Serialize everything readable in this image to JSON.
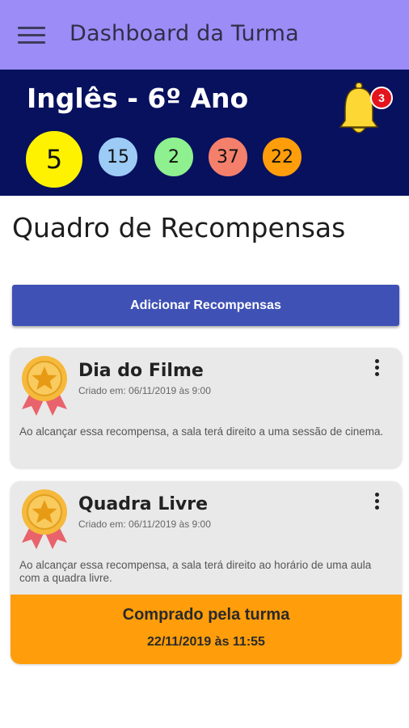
{
  "appbar": {
    "title": "Dashboard da Turma",
    "menu_icon": "hamburger-menu-icon",
    "color": "#9b8cf7"
  },
  "class_header": {
    "name": "Inglês - 6º Ano",
    "color": "#07115e",
    "notifications": {
      "icon": "bell-icon",
      "count": "3"
    },
    "stats": [
      {
        "value": "5",
        "color": "#fff200"
      },
      {
        "value": "15",
        "color": "#9ccbf5"
      },
      {
        "value": "2",
        "color": "#8ef08e"
      },
      {
        "value": "37",
        "color": "#f4806c"
      },
      {
        "value": "22",
        "color": "#ff9d0a"
      }
    ]
  },
  "rewards": {
    "section_title": "Quadro de Recompensas",
    "add_button_label": "Adicionar Recompensas",
    "items": [
      {
        "icon": "medal-icon",
        "title": "Dia do Filme",
        "created": "Criado em: 06/11/2019 às 9:00",
        "description": "Ao alcançar essa recompensa, a sala terá direito a uma sessão de cinema.",
        "menu_icon": "more-vert-icon"
      },
      {
        "icon": "medal-icon",
        "title": "Quadra Livre",
        "created": "Criado em: 06/11/2019 às 9:00",
        "description": "Ao alcançar essa recompensa, a sala terá direito ao horário de uma aula com a quadra livre.",
        "menu_icon": "more-vert-icon",
        "purchased": {
          "label": "Comprado pela turma",
          "date": "22/11/2019 às 11:55",
          "color": "#ff9d0a"
        }
      }
    ]
  }
}
